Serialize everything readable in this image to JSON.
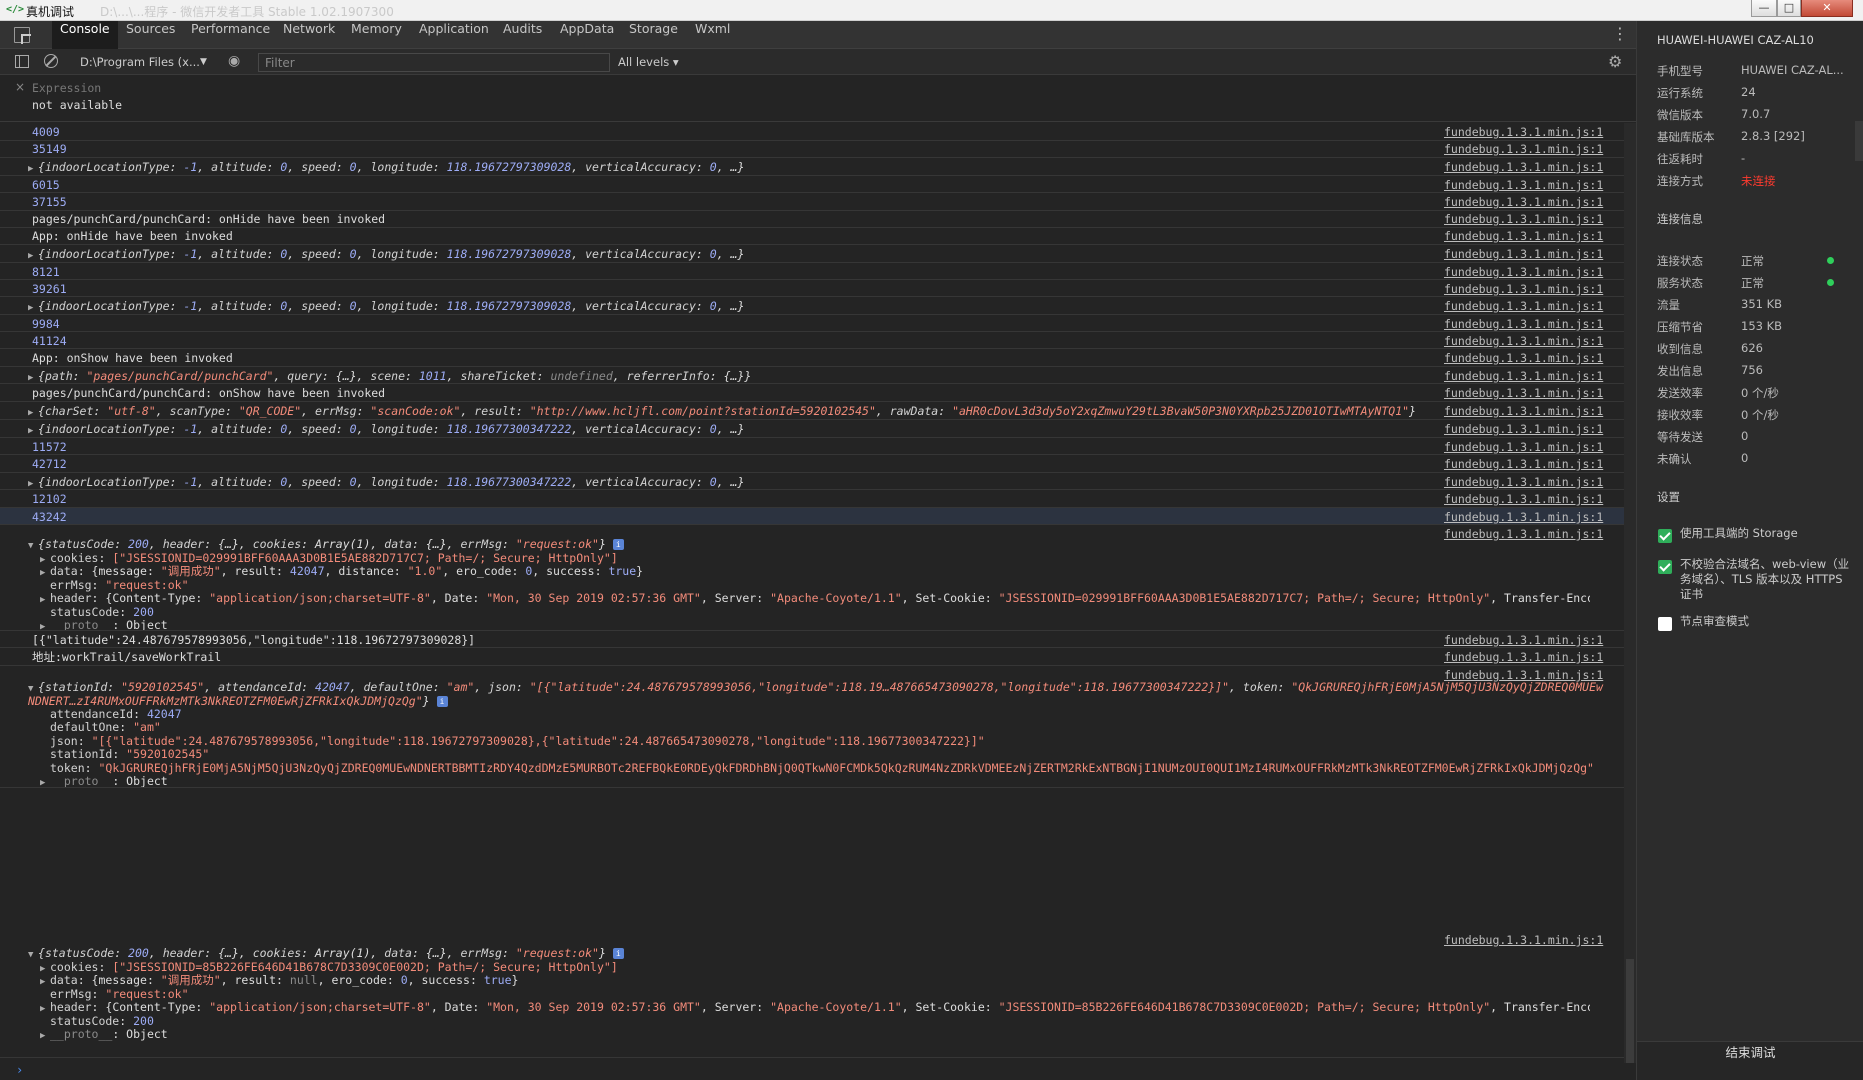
{
  "window": {
    "title": "真机调试",
    "faded_title": "D:\\...\\...程序 - 微信开发者工具 Stable 1.02.1907300",
    "minimize": "—",
    "maximize": "□",
    "close": "✕"
  },
  "tabs": [
    "Console",
    "Sources",
    "Performance",
    "Network",
    "Memory",
    "Application",
    "Audits",
    "AppData",
    "Storage",
    "Wxml"
  ],
  "toolbar": {
    "context": "D:\\Program Files (x...",
    "filter_placeholder": "Filter",
    "levels": "All levels ▾"
  },
  "watch": {
    "label": "Expression",
    "value": "not available"
  },
  "source_link": "fundebug.1.3.1.min.js:1",
  "logs": {
    "n4009": "4009",
    "n35149": "35149",
    "n6015": "6015",
    "n37155": "37155",
    "onhide_page": "pages/punchCard/punchCard: onHide have been invoked",
    "onhide_app": "App: onHide have been invoked",
    "n8121": "8121",
    "n39261": "39261",
    "n9984": "9984",
    "n41124": "41124",
    "onshow_app": "App: onShow have been invoked",
    "onshow_page": "pages/punchCard/punchCard: onShow have been invoked",
    "n11572": "11572",
    "n42712": "42712",
    "n12102": "12102",
    "n43242": "43242",
    "loc_lng_a": "118.19672797309028",
    "loc_lng_b": "118.19677300347222",
    "path_str": "\"pages/punchCard/punchCard\"",
    "scan_charset": "\"utf-8\"",
    "scan_type": "\"QR_CODE\"",
    "scan_errmsg": "\"scanCode:ok\"",
    "scan_result": "\"http://www.hcljfl.com/point?stationId=5920102545\"",
    "scan_raw": "\"aHR0cDovL3d3dy5oY2xqZmwuY29tL3BvaW50P3N0YXRpb25JZD01OTIwMTAyNTQ1\"",
    "json_line": "[{\"latitude\":24.487679578993056,\"longitude\":118.19672797309028}]",
    "addr_line": "地址:workTrail/saveWorkTrail",
    "r1_cookie": "[\"JSESSIONID=029991BFF60AAA3D0B1E5AE882D717C7; Path=/; Secure; HttpOnly\"]",
    "r1_data_msg": "\"调用成功\"",
    "r1_result": "42047",
    "r1_distance": "\"1.0\"",
    "r1_date": "\"Mon, 30 Sep 2019 02:57:36 GMT\"",
    "server": "\"Apache-Coyote/1.1\"",
    "r1_setcookie": "\"JSESSIONID=029991BFF60AAA3D0B1E5AE882D717C7; Path=/; Secure; HttpOnly\"",
    "req_ok": "\"request:ok\"",
    "st_id": "\"5920102545\"",
    "st_att": "42047",
    "st_def": "\"am\"",
    "st_json_short": "\"[{\"latitude\":24.487679578993056,\"longitude\":118.19…487665473090278,\"longitude\":118.19677300347222}]\"",
    "st_token_short": "\"QkJGRUREQjhFRjE0MjA5NjM5QjU3NzQyQjZDREQ0MUEwNDNERT…zI4RUMxOUFFRkMzMTk3NkREOTZFM0EwRjZFRkIxQkJDMjQzQg\"",
    "st_json_full": "\"[{\"latitude\":24.487679578993056,\"longitude\":118.19672797309028},{\"latitude\":24.487665473090278,\"longitude\":118.19677300347222}]\"",
    "st_token_full": "\"QkJGRUREQjhFRjE0MjA5NjM5QjU3NzQyQjZDREQ0MUEwNDNERTBBMTIzRDY4QzdDMzE5MURBOTc2REFBQkE0RDEyQkFDRDhBNjQ0QTkwN0FCMDk5QkQzRUM4NzZDRkVDMEEzNjZERTM2RkExNTBGNjI1NUMzOUI0QUI1MzI4RUMxOUFFRkMzMTk3NkREOTZFM0EwRjZFRkIxQkJDMjQzQg\"",
    "r2_cookie": "[\"JSESSIONID=85B226FE646D41B678C7D3309C0E002D; Path=/; Secure; HttpOnly\"]",
    "r2_setcookie": "\"JSESSIONID=85B226FE646D41B678C7D3309C0E002D; Path=/; Secure; HttpOnly\"",
    "status_200": "200",
    "object": "Object",
    "proto": "__proto__"
  },
  "panel": {
    "device": "HUAWEI-HUAWEI CAZ-AL10",
    "info": [
      {
        "k": "手机型号",
        "v": "HUAWEI CAZ-AL..."
      },
      {
        "k": "运行系统",
        "v": "24"
      },
      {
        "k": "微信版本",
        "v": "7.0.7"
      },
      {
        "k": "基础库版本",
        "v": "2.8.3 [292]"
      },
      {
        "k": "往返耗时",
        "v": "-"
      },
      {
        "k": "连接方式",
        "v": "未连接"
      }
    ],
    "conn_title": "连接信息",
    "conn": [
      {
        "k": "连接状态",
        "v": "正常"
      },
      {
        "k": "服务状态",
        "v": "正常"
      },
      {
        "k": "流量",
        "v": "351 KB"
      },
      {
        "k": "压缩节省",
        "v": "153 KB"
      },
      {
        "k": "收到信息",
        "v": "626"
      },
      {
        "k": "发出信息",
        "v": "756"
      },
      {
        "k": "发送效率",
        "v": "0 个/秒"
      },
      {
        "k": "接收效率",
        "v": "0 个/秒"
      },
      {
        "k": "等待发送",
        "v": "0"
      },
      {
        "k": "未确认",
        "v": "0"
      }
    ],
    "settings_title": "设置",
    "opt1": "使用工具端的 Storage",
    "opt2": "不校验合法域名、web-view（业务域名）、TLS 版本以及 HTTPS 证书",
    "opt3": "节点审查模式",
    "end_button": "结束调试",
    "status_color": "#2fcf5b",
    "warn_color": "#ff3b2f"
  }
}
